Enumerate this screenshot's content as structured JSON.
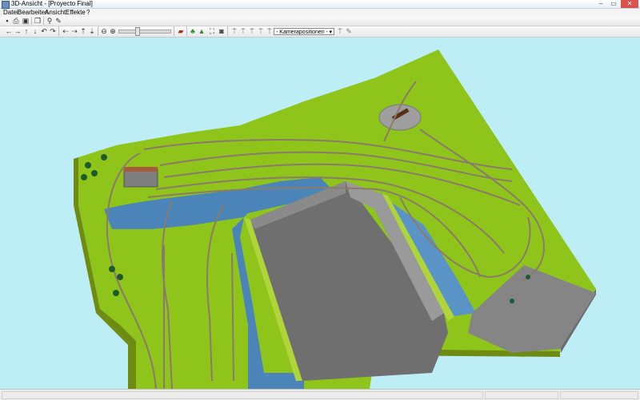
{
  "window": {
    "title": "3D-Ansicht - [Proyecto Final]"
  },
  "menu": [
    "Datei",
    "Bearbeiten",
    "Ansicht",
    "Effekte",
    "?"
  ],
  "toolbar": {
    "camera_dropdown": "- Kamerapositionen -",
    "icons": [
      "save-icon",
      "print-icon",
      "print-preview-icon",
      "copy-icon",
      "export-icon",
      "wand-icon",
      "arrow-left-icon",
      "arrow-right-icon",
      "arrow-up-icon",
      "arrow-down-icon",
      "rotate-left-icon",
      "rotate-right-icon",
      "walk-left-icon",
      "walk-right-icon",
      "walk-forward-icon",
      "walk-back-icon",
      "zoom-out-icon",
      "zoom-in-icon",
      "train-icon",
      "tree-icon",
      "landscape-icon",
      "fullscreen-icon",
      "camera-icon",
      "camera-1-icon",
      "camera-2-icon",
      "camera-3-icon",
      "camera-4-icon",
      "camera-5-icon",
      "cam-settings-icon",
      "cam-add-icon"
    ]
  },
  "scene": {
    "background_color": "#bdeef6",
    "grass_color": "#8fc51a",
    "water_color": "#4b84b8",
    "pit_color": "#6f6f6f",
    "cliff_color": "#858585",
    "track_color": "#8b7a6b"
  }
}
